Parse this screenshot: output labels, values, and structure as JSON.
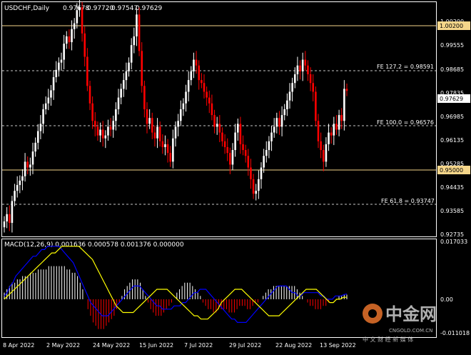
{
  "header": {
    "symbol": "USDCHF,Daily",
    "ohlc": [
      "0.97678",
      "0.97720",
      "0.97547",
      "0.97629"
    ]
  },
  "price_axis": {
    "ticks": [
      "1.00200",
      "0.99555",
      "0.98685",
      "0.97835",
      "0.96985",
      "0.96135",
      "0.95285",
      "0.94435",
      "0.93585",
      "0.92735"
    ],
    "highlights": [
      {
        "label": "1.00200",
        "color": "#f5d68a"
      },
      {
        "label": "0.97629",
        "color": "#ffffff"
      },
      {
        "label": "0.95000",
        "color": "#f5d68a"
      }
    ]
  },
  "levels": [
    {
      "label": "FE 127.2 = 0.98591",
      "style": "dashed"
    },
    {
      "label": "FE 100.0 = 0.96576",
      "style": "dashed"
    },
    {
      "label": "FE 61.8 = 0.93747",
      "style": "dashed"
    },
    {
      "label": "1.00200",
      "style": "solid"
    },
    {
      "label": "0.95000",
      "style": "solid"
    }
  ],
  "macd": {
    "label": "MACD(12,26,9) 0.001636 0.000578 0.001376 0.000000",
    "ticks": [
      "0.017033",
      "0.00",
      "-0.011018"
    ]
  },
  "time_axis": {
    "ticks": [
      "8 Apr 2022",
      "2 May 2022",
      "24 May 2022",
      "15 Jun 2022",
      "7 Jul 2022",
      "29 Jul 2022",
      "22 Aug 2022",
      "13 Sep 2022"
    ]
  },
  "watermark": {
    "brand": "中金网",
    "domain": "CNGOLD.COM.CN",
    "tagline": "中 文 财 经 新 媒 体"
  },
  "colors": {
    "bull": "#ffffff",
    "bear": "#ff0000",
    "level_line": "#f5d68a",
    "signal": "#ffff00",
    "macd_line": "#0000ff"
  },
  "chart_data": {
    "type": "candlestick",
    "symbol": "USDCHF",
    "timeframe": "Daily",
    "ylim": [
      0.9266,
      1.0065
    ],
    "closes": [
      0.9315,
      0.934,
      0.931,
      0.9385,
      0.942,
      0.944,
      0.9455,
      0.947,
      0.952,
      0.95,
      0.951,
      0.9555,
      0.9585,
      0.9625,
      0.965,
      0.97,
      0.972,
      0.974,
      0.9765,
      0.981,
      0.9835,
      0.986,
      0.987,
      0.9925,
      0.995,
      0.993,
      0.9975,
      0.9995,
      1.004,
      1.005,
      0.996,
      0.988,
      0.978,
      0.972,
      0.966,
      0.964,
      0.961,
      0.963,
      0.96,
      0.961,
      0.964,
      0.963,
      0.966,
      0.97,
      0.974,
      0.977,
      0.98,
      0.983,
      0.986,
      0.992,
      0.995,
      1.0025,
      0.99,
      0.978,
      0.97,
      0.965,
      0.967,
      0.962,
      0.96,
      0.964,
      0.959,
      0.957,
      0.958,
      0.955,
      0.952,
      0.96,
      0.964,
      0.966,
      0.97,
      0.972,
      0.976,
      0.98,
      0.983,
      0.987,
      0.985,
      0.98,
      0.979,
      0.976,
      0.974,
      0.972,
      0.968,
      0.964,
      0.965,
      0.962,
      0.959,
      0.957,
      0.955,
      0.951,
      0.956,
      0.962,
      0.965,
      0.958,
      0.956,
      0.954,
      0.95,
      0.946,
      0.941,
      0.942,
      0.946,
      0.95,
      0.954,
      0.956,
      0.959,
      0.962,
      0.964,
      0.967,
      0.964,
      0.968,
      0.97,
      0.973,
      0.976,
      0.979,
      0.982,
      0.985,
      0.983,
      0.987,
      0.985,
      0.982,
      0.979,
      0.976,
      0.966,
      0.959,
      0.956,
      0.952,
      0.958,
      0.962,
      0.961,
      0.965,
      0.963,
      0.968,
      0.966,
      0.977,
      0.9763
    ]
  },
  "macd_data": {
    "ylim": [
      -0.011018,
      0.017033
    ],
    "histogram": [
      0.002,
      0.003,
      0.004,
      0.005,
      0.005,
      0.006,
      0.006,
      0.007,
      0.007,
      0.007,
      0.008,
      0.008,
      0.008,
      0.009,
      0.009,
      0.009,
      0.009,
      0.01,
      0.01,
      0.01,
      0.01,
      0.01,
      0.01,
      0.01,
      0.009,
      0.009,
      0.008,
      0.008,
      0.007,
      0.005,
      0.003,
      0.0,
      -0.003,
      -0.005,
      -0.007,
      -0.008,
      -0.009,
      -0.009,
      -0.009,
      -0.008,
      -0.007,
      -0.006,
      -0.005,
      -0.003,
      -0.001,
      0.001,
      0.003,
      0.004,
      0.005,
      0.006,
      0.006,
      0.006,
      0.005,
      0.003,
      0.001,
      -0.001,
      -0.003,
      -0.004,
      -0.005,
      -0.005,
      -0.005,
      -0.004,
      -0.003,
      -0.002,
      -0.001,
      0.0,
      0.002,
      0.003,
      0.004,
      0.005,
      0.005,
      0.005,
      0.004,
      0.003,
      0.002,
      0.001,
      -0.001,
      -0.002,
      -0.003,
      -0.003,
      -0.004,
      -0.004,
      -0.003,
      -0.003,
      -0.003,
      -0.003,
      -0.004,
      -0.004,
      -0.004,
      -0.003,
      -0.002,
      -0.002,
      -0.002,
      -0.003,
      -0.003,
      -0.002,
      -0.001,
      -0.001,
      0.0,
      0.001,
      0.002,
      0.003,
      0.003,
      0.004,
      0.004,
      0.004,
      0.004,
      0.004,
      0.004,
      0.004,
      0.004,
      0.004,
      0.003,
      0.002,
      0.001,
      0.0,
      -0.001,
      -0.002,
      -0.002,
      -0.003,
      -0.003,
      -0.003,
      -0.002,
      -0.002,
      -0.001,
      0.0,
      0.0,
      0.0,
      0.001,
      0.001,
      0.0014,
      0.0014
    ],
    "macd_line": [
      0.001,
      0.002,
      0.004,
      0.005,
      0.007,
      0.008,
      0.009,
      0.01,
      0.011,
      0.012,
      0.013,
      0.013,
      0.014,
      0.015,
      0.015,
      0.016,
      0.016,
      0.016,
      0.016,
      0.016,
      0.015,
      0.014,
      0.013,
      0.012,
      0.011,
      0.009,
      0.007,
      0.005,
      0.003,
      0.001,
      -0.001,
      -0.002,
      -0.003,
      -0.004,
      -0.005,
      -0.005,
      -0.005,
      -0.004,
      -0.003,
      -0.002,
      -0.001,
      0.0,
      0.001,
      0.002,
      0.003,
      0.004,
      0.004,
      0.004,
      0.003,
      0.002,
      0.001,
      0.0,
      -0.001,
      -0.002,
      -0.002,
      -0.003,
      -0.003,
      -0.003,
      -0.003,
      -0.002,
      -0.002,
      -0.002,
      -0.001,
      -0.001,
      0.0,
      0.001,
      0.002,
      0.002,
      0.003,
      0.003,
      0.003,
      0.002,
      0.001,
      0.0,
      -0.001,
      -0.002,
      -0.003,
      -0.004,
      -0.005,
      -0.006,
      -0.006,
      -0.007,
      -0.007,
      -0.007,
      -0.007,
      -0.006,
      -0.005,
      -0.004,
      -0.003,
      -0.002,
      -0.001,
      0.0,
      0.001,
      0.002,
      0.003,
      0.004,
      0.004,
      0.004,
      0.004,
      0.003,
      0.002,
      0.002,
      0.001,
      0.001,
      0.002,
      0.002,
      0.002,
      0.002,
      0.002,
      0.002,
      0.001,
      0.001,
      0.0,
      0.0,
      0.0,
      0.001,
      0.001,
      0.001,
      0.0014,
      0.0016
    ],
    "signal_line": [
      0.0,
      0.001,
      0.002,
      0.003,
      0.004,
      0.005,
      0.006,
      0.007,
      0.008,
      0.009,
      0.01,
      0.011,
      0.012,
      0.013,
      0.014,
      0.014,
      0.015,
      0.016,
      0.016,
      0.016,
      0.016,
      0.016,
      0.016,
      0.015,
      0.014,
      0.013,
      0.012,
      0.01,
      0.008,
      0.006,
      0.004,
      0.002,
      0.0,
      -0.002,
      -0.003,
      -0.004,
      -0.004,
      -0.004,
      -0.004,
      -0.003,
      -0.002,
      -0.001,
      0.0,
      0.001,
      0.002,
      0.003,
      0.003,
      0.003,
      0.003,
      0.002,
      0.001,
      0.0,
      -0.001,
      -0.002,
      -0.003,
      -0.004,
      -0.005,
      -0.005,
      -0.006,
      -0.006,
      -0.006,
      -0.005,
      -0.004,
      -0.003,
      -0.001,
      0.0,
      0.001,
      0.002,
      0.003,
      0.003,
      0.003,
      0.002,
      0.001,
      0.0,
      -0.001,
      -0.002,
      -0.003,
      -0.004,
      -0.005,
      -0.005,
      -0.005,
      -0.005,
      -0.004,
      -0.003,
      -0.002,
      -0.001,
      0.0,
      0.001,
      0.002,
      0.003,
      0.003,
      0.003,
      0.003,
      0.002,
      0.001,
      0.0,
      -0.001,
      -0.001,
      0.0,
      0.0,
      0.0006,
      0.0006
    ]
  }
}
